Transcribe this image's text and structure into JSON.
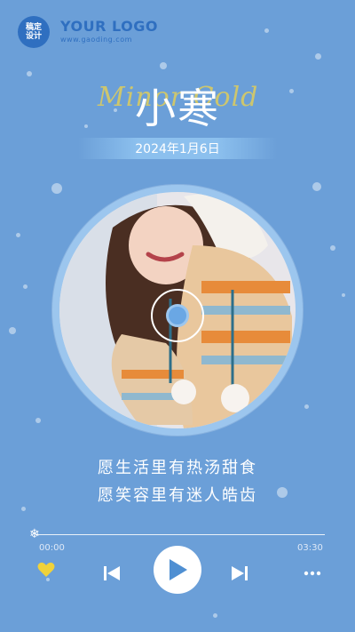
{
  "logo": {
    "badge_text": "稿定设计",
    "title": "YOUR LOGO",
    "subtitle": "www.gaoding.com"
  },
  "header": {
    "title": "小寒",
    "script_text": "Minor Cold",
    "date": "2024年1月6日"
  },
  "lyrics": [
    "愿生活里有热汤甜食",
    "愿笑容里有迷人皓齿"
  ],
  "player": {
    "time_current": "00:00",
    "time_total": "03:30",
    "progress": 0.0,
    "liked": true
  },
  "colors": {
    "background": "#6b9fd8",
    "accent": "#2f6fc0",
    "heart": "#f0d23a"
  },
  "icons": {
    "heart": "heart-icon",
    "previous": "previous-icon",
    "play": "play-icon",
    "next": "next-icon",
    "more": "more-icon",
    "knob": "snowflake-icon"
  }
}
